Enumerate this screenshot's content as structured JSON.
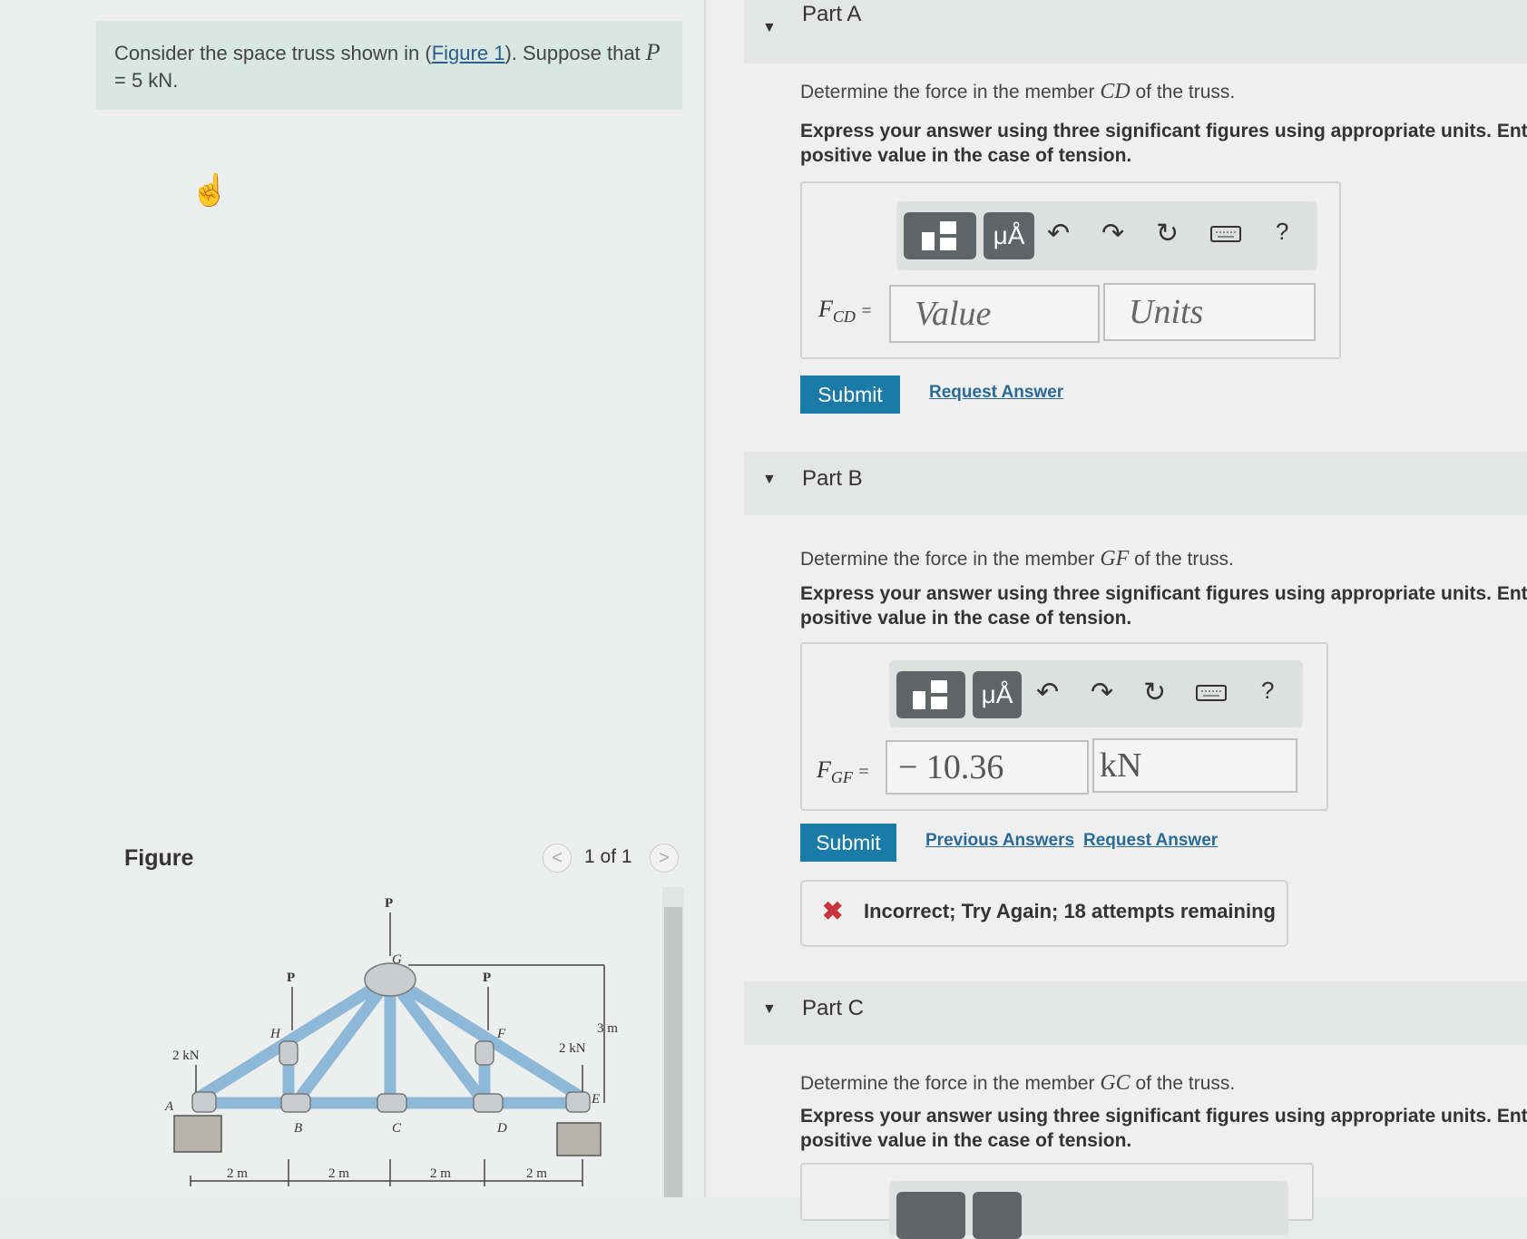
{
  "problem": {
    "text_before_link": "Consider the space truss shown in (",
    "link": "Figure 1",
    "text_after_link": "). Suppose that ",
    "var": "P",
    "value_line": "= 5 kN."
  },
  "figure": {
    "label": "Figure",
    "page_indicator": "1 of 1",
    "prev": "<",
    "next": ">",
    "labels": {
      "P_top": "P",
      "P_left": "P",
      "P_right": "P",
      "load_left": "2 kN",
      "load_right": "2 kN",
      "G": "G",
      "H": "H",
      "F": "F",
      "A": "A",
      "B": "B",
      "C": "C",
      "D": "D",
      "E": "E",
      "height": "3 m",
      "span1": "2 m",
      "span2": "2 m",
      "span3": "2 m",
      "span4": "2 m"
    }
  },
  "toolbar": {
    "templates_icon": "templates-icon",
    "units_label": "μÅ",
    "undo": "↶",
    "redo": "↷",
    "reset": "↻",
    "keyboard_icon": "keyboard-icon",
    "help": "?"
  },
  "parts": [
    {
      "title": "Part A",
      "question_pre": "Determine the force in the member ",
      "member": "CD",
      "question_post": " of the truss.",
      "instructions_l1": "Express your answer using three significant figures using appropriate units. Enter a",
      "instructions_l2": "positive value in the case of tension.",
      "lhs": "F",
      "lhs_sub": "CD",
      "eq": "=",
      "value_placeholder": "Value",
      "units_placeholder": "Units",
      "submit": "Submit",
      "request": "Request Answer"
    },
    {
      "title": "Part B",
      "question_pre": "Determine the force in the member ",
      "member": "GF",
      "question_post": " of the truss.",
      "instructions_l1": "Express your answer using three significant figures using appropriate units. Enter a",
      "instructions_l2": "positive value in the case of tension.",
      "lhs": "F",
      "lhs_sub": "GF",
      "eq": "=",
      "value": "− 10.36",
      "units": "kN",
      "submit": "Submit",
      "previous": "Previous Answers",
      "request": "Request Answer",
      "feedback": "Incorrect; Try Again; 18 attempts remaining",
      "feedback_icon": "✖"
    },
    {
      "title": "Part C",
      "question_pre": "Determine the force in the member ",
      "member": "GC",
      "question_post": " of the truss.",
      "instructions_l1": "Express your answer using three significant figures using appropriate units. Enter a",
      "instructions_l2": "positive value in the case of tension."
    }
  ]
}
